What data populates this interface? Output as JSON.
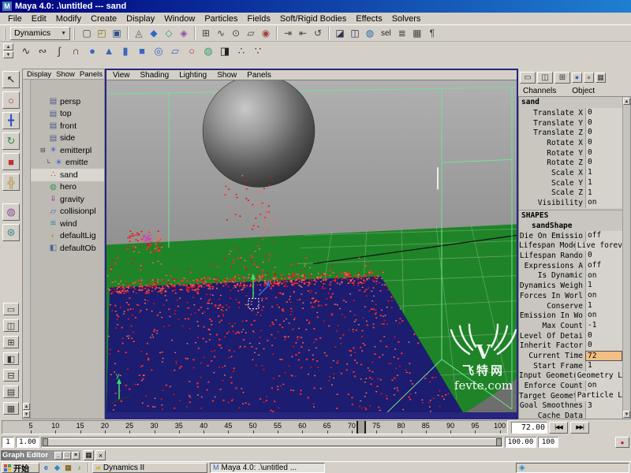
{
  "window": {
    "title": "Maya 4.0: .\\untitled --- sand"
  },
  "icons": {
    "maya_logo": "M",
    "dropdown": "▼",
    "scroll_up": "▲",
    "scroll_down": "▼",
    "tab_up": "▲",
    "tab_down": "▼"
  },
  "menubar": {
    "items": [
      "File",
      "Edit",
      "Modify",
      "Create",
      "Display",
      "Window",
      "Particles",
      "Fields",
      "Soft/Rigid Bodies",
      "Effects",
      "Solvers"
    ]
  },
  "toolbar": {
    "mode": "Dynamics",
    "sel_label": "sel",
    "icons": [
      {
        "name": "new-scene-icon",
        "glyph": "▢",
        "color": "#444444"
      },
      {
        "name": "open-scene-icon",
        "glyph": "◰",
        "color": "#8a6a1a"
      },
      {
        "name": "save-scene-icon",
        "glyph": "▣",
        "color": "#33508a"
      },
      {
        "name": "separator",
        "glyph": "",
        "sep": true
      },
      {
        "name": "select-hierarchy-icon",
        "glyph": "◬",
        "color": "#555555"
      },
      {
        "name": "select-objects-icon",
        "glyph": "◆",
        "color": "#2b66cc"
      },
      {
        "name": "select-components-icon",
        "glyph": "◇",
        "color": "#2ba066"
      },
      {
        "name": "select-hulls-icon",
        "glyph": "◈",
        "color": "#8a4aaa"
      },
      {
        "name": "separator",
        "glyph": "",
        "sep": true
      },
      {
        "name": "snap-to-grid-icon",
        "glyph": "⊞",
        "color": "#444444"
      },
      {
        "name": "snap-to-curve-icon",
        "glyph": "∿",
        "color": "#444444"
      },
      {
        "name": "snap-to-point-icon",
        "glyph": "⊙",
        "color": "#444444"
      },
      {
        "name": "snap-to-plane-icon",
        "glyph": "▱",
        "color": "#444444"
      },
      {
        "name": "make-live-icon",
        "glyph": "◉",
        "color": "#a04444"
      },
      {
        "name": "separator",
        "glyph": "",
        "sep": true
      },
      {
        "name": "input-connections-icon",
        "glyph": "⇥",
        "color": "#444444"
      },
      {
        "name": "output-connections-icon",
        "glyph": "⇤",
        "color": "#444444"
      },
      {
        "name": "construction-history-icon",
        "glyph": "↺",
        "color": "#444444"
      },
      {
        "name": "separator",
        "glyph": "",
        "sep": true
      },
      {
        "name": "render-frame-icon",
        "glyph": "◪",
        "color": "#333355"
      },
      {
        "name": "ipr-render-icon",
        "glyph": "◫",
        "color": "#333355"
      },
      {
        "name": "render-globe-icon",
        "glyph": "◍",
        "color": "#2b66aa"
      }
    ],
    "right_icons": [
      {
        "name": "list-view-icon",
        "glyph": "≣",
        "color": "#444444"
      },
      {
        "name": "grid-view-icon",
        "glyph": "▦",
        "color": "#444444"
      },
      {
        "name": "script-editor-icon",
        "glyph": "¶",
        "color": "#444444"
      }
    ]
  },
  "shelf": {
    "icons": [
      {
        "name": "cv-curve-tool-icon",
        "glyph": "∿",
        "color": "#333333"
      },
      {
        "name": "ep-curve-tool-icon",
        "glyph": "∾",
        "color": "#333333"
      },
      {
        "name": "pencil-curve-tool-icon",
        "glyph": "∫",
        "color": "#333333"
      },
      {
        "name": "arc-tool-icon",
        "glyph": "∩",
        "color": "#333333"
      },
      {
        "name": "nurbs-sphere-icon",
        "glyph": "●",
        "color": "#3a66c0"
      },
      {
        "name": "nurbs-cone-icon",
        "glyph": "▲",
        "color": "#3a66c0"
      },
      {
        "name": "nurbs-cylinder-icon",
        "glyph": "▮",
        "color": "#3a66c0"
      },
      {
        "name": "nurbs-cube-icon",
        "glyph": "■",
        "color": "#3a66c0"
      },
      {
        "name": "nurbs-torus-icon",
        "glyph": "◎",
        "color": "#3a66c0"
      },
      {
        "name": "nurbs-plane-icon",
        "glyph": "▱",
        "color": "#3a66c0"
      },
      {
        "name": "nurbs-circle-icon",
        "glyph": "○",
        "color": "#b03030"
      },
      {
        "name": "poly-sphere-icon",
        "glyph": "◍",
        "color": "#3aa070"
      },
      {
        "name": "camera-icon",
        "glyph": "◨",
        "color": "#222222"
      },
      {
        "name": "emitter-shelf-icon",
        "glyph": "∴",
        "color": "#223355"
      },
      {
        "name": "particles-shelf-icon",
        "glyph": "∵",
        "color": "#223355"
      }
    ]
  },
  "toolbox": {
    "tools": [
      {
        "name": "select-tool-icon",
        "glyph": "↖",
        "color": "#111111"
      },
      {
        "name": "lasso-tool-icon",
        "glyph": "○",
        "color": "#b03030"
      },
      {
        "name": "move-tool-icon",
        "glyph": "╋",
        "color": "#2b50c8"
      },
      {
        "name": "rotate-tool-icon",
        "glyph": "↻",
        "color": "#2b8a4a"
      },
      {
        "name": "scale-tool-icon",
        "glyph": "■",
        "color": "#c03030"
      },
      {
        "name": "manipulator-tool-icon",
        "glyph": "╬",
        "color": "#b08a2a"
      }
    ],
    "extra": [
      {
        "name": "soft-mod-tool-icon",
        "glyph": "◍",
        "color": "#8a4a9a"
      },
      {
        "name": "paint-tool-icon",
        "glyph": "⊛",
        "color": "#3a8a8a"
      }
    ],
    "layouts": [
      {
        "name": "layout-single-pane-icon",
        "glyph": "▭"
      },
      {
        "name": "layout-two-pane-icon",
        "glyph": "◫"
      },
      {
        "name": "layout-four-pane-icon",
        "glyph": "⊞"
      },
      {
        "name": "layout-outliner-persp-icon",
        "glyph": "◧"
      },
      {
        "name": "layout-graph-persp-icon",
        "glyph": "⊟"
      },
      {
        "name": "layout-hypergraph-icon",
        "glyph": "▤"
      },
      {
        "name": "layout-multi-pane-icon",
        "glyph": "▦"
      }
    ]
  },
  "outliner": {
    "menu": [
      "Display",
      "Show",
      "Panels"
    ],
    "items": [
      {
        "label": "persp",
        "prefix": "",
        "icon": "camera-icon",
        "icon_glyph": "▤",
        "icon_color": "#4a5a8a"
      },
      {
        "label": "top",
        "prefix": "",
        "icon": "camera-icon",
        "icon_glyph": "▤",
        "icon_color": "#4a5a8a"
      },
      {
        "label": "front",
        "prefix": "",
        "icon": "camera-icon",
        "icon_glyph": "▤",
        "icon_color": "#4a5a8a"
      },
      {
        "label": "side",
        "prefix": "",
        "icon": "camera-icon",
        "icon_glyph": "▤",
        "icon_color": "#4a5a8a"
      },
      {
        "label": "emitterpl",
        "prefix": "⊟",
        "icon": "emitter-icon",
        "icon_glyph": "☀",
        "icon_color": "#3a5ae0"
      },
      {
        "label": "emitte",
        "prefix": "└",
        "child": true,
        "icon": "emitter-icon",
        "icon_glyph": "☀",
        "icon_color": "#3a5ae0"
      },
      {
        "label": "sand",
        "prefix": "",
        "selected": true,
        "icon": "particles-icon",
        "icon_glyph": "∴",
        "icon_color": "#c03030"
      },
      {
        "label": "hero",
        "prefix": "",
        "icon": "mesh-icon",
        "icon_glyph": "◍",
        "icon_color": "#2a9a4a"
      },
      {
        "label": "gravity",
        "prefix": "",
        "icon": "gravity-field-icon",
        "icon_glyph": "⇓",
        "icon_color": "#9a3aaa"
      },
      {
        "label": "collisionpl",
        "prefix": "",
        "icon": "collision-plane-icon",
        "icon_glyph": "▱",
        "icon_color": "#3a6ac0"
      },
      {
        "label": "wind",
        "prefix": "",
        "icon": "wind-field-icon",
        "icon_glyph": "≋",
        "icon_color": "#2a8aaa"
      },
      {
        "label": "defaultLig",
        "prefix": "",
        "icon": "light-set-icon",
        "icon_glyph": "◐",
        "icon_color": "#b09a2a"
      },
      {
        "label": "defaultOb",
        "prefix": "",
        "icon": "object-set-icon",
        "icon_glyph": "◧",
        "icon_color": "#4a6a9a"
      }
    ]
  },
  "viewport": {
    "menu": [
      "View",
      "Shading",
      "Lighting",
      "Show",
      "Panels"
    ],
    "axis_label": "y",
    "watermark": {
      "logo": "V",
      "line1": "飞特网",
      "line2": "fevte.com"
    }
  },
  "channel_box": {
    "menu": [
      "Channels",
      "Object"
    ],
    "panel_icons": [
      {
        "name": "layout-preset-single-icon",
        "glyph": "▭",
        "color": "#333333"
      },
      {
        "name": "layout-preset-split-icon",
        "glyph": "◫",
        "color": "#333333"
      },
      {
        "name": "layout-preset-quad-icon",
        "glyph": "⊞",
        "color": "#333333"
      },
      {
        "name": "status-blue-icon",
        "glyph": "●",
        "color": "#3a66c0",
        "small": true
      },
      {
        "name": "status-gray-icon",
        "glyph": "●",
        "color": "#8a8a8a",
        "small": true
      },
      {
        "name": "channel-menu-icon",
        "glyph": "▦",
        "color": "#333333",
        "small": true
      }
    ],
    "node_name": "sand",
    "transform_rows": [
      {
        "name": "Translate X",
        "value": "0"
      },
      {
        "name": "Translate Y",
        "value": "0"
      },
      {
        "name": "Translate Z",
        "value": "0"
      },
      {
        "name": "Rotate X",
        "value": "0"
      },
      {
        "name": "Rotate Y",
        "value": "0"
      },
      {
        "name": "Rotate Z",
        "value": "0"
      },
      {
        "name": "Scale X",
        "value": "1"
      },
      {
        "name": "Scale Y",
        "value": "1"
      },
      {
        "name": "Scale Z",
        "value": "1"
      },
      {
        "name": "Visibility",
        "value": "on"
      }
    ],
    "shapes_label": "SHAPES",
    "shape_node_name": "sandShape",
    "shape_rows": [
      {
        "name": "Die On Emissio",
        "value": "off"
      },
      {
        "name": "Lifespan Mode",
        "value": "Live forev"
      },
      {
        "name": "Lifespan Rando",
        "value": "0"
      },
      {
        "name": "Expressions A",
        "value": "off"
      },
      {
        "name": "Is Dynamic",
        "value": "on"
      },
      {
        "name": "Dynamics Weigh",
        "value": "1"
      },
      {
        "name": "Forces In Worl",
        "value": "on"
      },
      {
        "name": "Conserve",
        "value": "1"
      },
      {
        "name": "Emission In Wo",
        "value": "on"
      },
      {
        "name": "Max Count",
        "value": "-1"
      },
      {
        "name": "Level Of Detai",
        "value": "0"
      },
      {
        "name": "Inherit Factor",
        "value": "0"
      },
      {
        "name": "Current Time",
        "value": "72",
        "highlight": true
      },
      {
        "name": "Start Frame",
        "value": "1"
      },
      {
        "name": "Input Geometry",
        "value": "Geometry L"
      },
      {
        "name": "Enforce Count",
        "value": "on"
      },
      {
        "name": "Target Geometr",
        "value": "Particle L"
      },
      {
        "name": "Goal Smoothnes",
        "value": "3"
      },
      {
        "name": "Cache Data",
        "value": ""
      }
    ]
  },
  "timeline": {
    "ticks": [
      "5",
      "10",
      "15",
      "20",
      "25",
      "30",
      "35",
      "40",
      "45",
      "50",
      "55",
      "60",
      "65",
      "70",
      "75",
      "80",
      "85",
      "90",
      "95",
      "100"
    ],
    "current_frame": 72,
    "current_time_field": "72.00",
    "buttons": [
      {
        "name": "step-back-button",
        "glyph": "|◀◀"
      },
      {
        "name": "step-forward-button",
        "glyph": "▶▶|"
      }
    ],
    "range": {
      "start": "1",
      "start_precise": "1.00",
      "end_precise": "100.00",
      "end": "100"
    },
    "autokey_glyph": "●"
  },
  "graph_editor": {
    "title": "Graph Editor",
    "window_buttons": [
      {
        "name": "minimize-icon",
        "glyph": "_"
      },
      {
        "name": "restore-icon",
        "glyph": "□"
      },
      {
        "name": "close-icon",
        "glyph": "×"
      }
    ],
    "side_buttons": [
      {
        "name": "panel-menu-icon",
        "glyph": "▦"
      },
      {
        "name": "panel-close-icon",
        "glyph": "×"
      }
    ]
  },
  "taskbar": {
    "start_label": "开始",
    "quick_launch": [
      {
        "name": "ie-icon",
        "glyph": "e",
        "color": "#2b66cc"
      },
      {
        "name": "outlook-icon",
        "glyph": "◆",
        "color": "#2b8acc"
      },
      {
        "name": "desktop-icon",
        "glyph": "▦",
        "color": "#8a6a2a"
      },
      {
        "name": "media-player-icon",
        "glyph": "♪",
        "color": "#2b8a4a"
      }
    ],
    "tasks": [
      {
        "label": "Dynamics II",
        "icon": "folder-icon",
        "icon_glyph": "▰",
        "icon_color": "#d8b23a",
        "active": false
      },
      {
        "label": "Maya 4.0: .\\untitled ...",
        "icon": "maya-icon",
        "icon_glyph": "M",
        "icon_color": "#3a5ac0",
        "active": true
      }
    ],
    "tray_icon": "◈"
  }
}
